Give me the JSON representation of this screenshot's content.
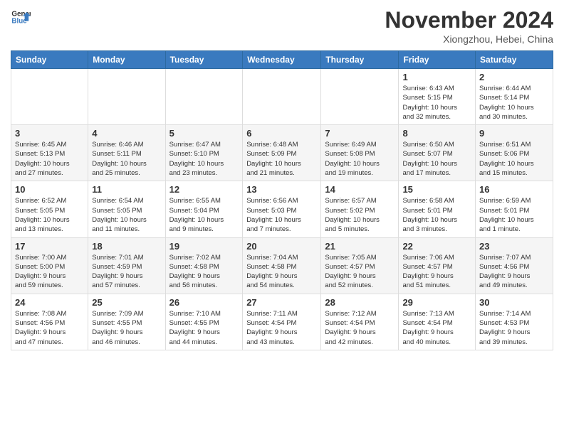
{
  "header": {
    "logo_line1": "General",
    "logo_line2": "Blue",
    "month": "November 2024",
    "location": "Xiongzhou, Hebei, China"
  },
  "weekdays": [
    "Sunday",
    "Monday",
    "Tuesday",
    "Wednesday",
    "Thursday",
    "Friday",
    "Saturday"
  ],
  "weeks": [
    [
      {
        "day": "",
        "info": ""
      },
      {
        "day": "",
        "info": ""
      },
      {
        "day": "",
        "info": ""
      },
      {
        "day": "",
        "info": ""
      },
      {
        "day": "",
        "info": ""
      },
      {
        "day": "1",
        "info": "Sunrise: 6:43 AM\nSunset: 5:15 PM\nDaylight: 10 hours\nand 32 minutes."
      },
      {
        "day": "2",
        "info": "Sunrise: 6:44 AM\nSunset: 5:14 PM\nDaylight: 10 hours\nand 30 minutes."
      }
    ],
    [
      {
        "day": "3",
        "info": "Sunrise: 6:45 AM\nSunset: 5:13 PM\nDaylight: 10 hours\nand 27 minutes."
      },
      {
        "day": "4",
        "info": "Sunrise: 6:46 AM\nSunset: 5:11 PM\nDaylight: 10 hours\nand 25 minutes."
      },
      {
        "day": "5",
        "info": "Sunrise: 6:47 AM\nSunset: 5:10 PM\nDaylight: 10 hours\nand 23 minutes."
      },
      {
        "day": "6",
        "info": "Sunrise: 6:48 AM\nSunset: 5:09 PM\nDaylight: 10 hours\nand 21 minutes."
      },
      {
        "day": "7",
        "info": "Sunrise: 6:49 AM\nSunset: 5:08 PM\nDaylight: 10 hours\nand 19 minutes."
      },
      {
        "day": "8",
        "info": "Sunrise: 6:50 AM\nSunset: 5:07 PM\nDaylight: 10 hours\nand 17 minutes."
      },
      {
        "day": "9",
        "info": "Sunrise: 6:51 AM\nSunset: 5:06 PM\nDaylight: 10 hours\nand 15 minutes."
      }
    ],
    [
      {
        "day": "10",
        "info": "Sunrise: 6:52 AM\nSunset: 5:05 PM\nDaylight: 10 hours\nand 13 minutes."
      },
      {
        "day": "11",
        "info": "Sunrise: 6:54 AM\nSunset: 5:05 PM\nDaylight: 10 hours\nand 11 minutes."
      },
      {
        "day": "12",
        "info": "Sunrise: 6:55 AM\nSunset: 5:04 PM\nDaylight: 10 hours\nand 9 minutes."
      },
      {
        "day": "13",
        "info": "Sunrise: 6:56 AM\nSunset: 5:03 PM\nDaylight: 10 hours\nand 7 minutes."
      },
      {
        "day": "14",
        "info": "Sunrise: 6:57 AM\nSunset: 5:02 PM\nDaylight: 10 hours\nand 5 minutes."
      },
      {
        "day": "15",
        "info": "Sunrise: 6:58 AM\nSunset: 5:01 PM\nDaylight: 10 hours\nand 3 minutes."
      },
      {
        "day": "16",
        "info": "Sunrise: 6:59 AM\nSunset: 5:01 PM\nDaylight: 10 hours\nand 1 minute."
      }
    ],
    [
      {
        "day": "17",
        "info": "Sunrise: 7:00 AM\nSunset: 5:00 PM\nDaylight: 9 hours\nand 59 minutes."
      },
      {
        "day": "18",
        "info": "Sunrise: 7:01 AM\nSunset: 4:59 PM\nDaylight: 9 hours\nand 57 minutes."
      },
      {
        "day": "19",
        "info": "Sunrise: 7:02 AM\nSunset: 4:58 PM\nDaylight: 9 hours\nand 56 minutes."
      },
      {
        "day": "20",
        "info": "Sunrise: 7:04 AM\nSunset: 4:58 PM\nDaylight: 9 hours\nand 54 minutes."
      },
      {
        "day": "21",
        "info": "Sunrise: 7:05 AM\nSunset: 4:57 PM\nDaylight: 9 hours\nand 52 minutes."
      },
      {
        "day": "22",
        "info": "Sunrise: 7:06 AM\nSunset: 4:57 PM\nDaylight: 9 hours\nand 51 minutes."
      },
      {
        "day": "23",
        "info": "Sunrise: 7:07 AM\nSunset: 4:56 PM\nDaylight: 9 hours\nand 49 minutes."
      }
    ],
    [
      {
        "day": "24",
        "info": "Sunrise: 7:08 AM\nSunset: 4:56 PM\nDaylight: 9 hours\nand 47 minutes."
      },
      {
        "day": "25",
        "info": "Sunrise: 7:09 AM\nSunset: 4:55 PM\nDaylight: 9 hours\nand 46 minutes."
      },
      {
        "day": "26",
        "info": "Sunrise: 7:10 AM\nSunset: 4:55 PM\nDaylight: 9 hours\nand 44 minutes."
      },
      {
        "day": "27",
        "info": "Sunrise: 7:11 AM\nSunset: 4:54 PM\nDaylight: 9 hours\nand 43 minutes."
      },
      {
        "day": "28",
        "info": "Sunrise: 7:12 AM\nSunset: 4:54 PM\nDaylight: 9 hours\nand 42 minutes."
      },
      {
        "day": "29",
        "info": "Sunrise: 7:13 AM\nSunset: 4:54 PM\nDaylight: 9 hours\nand 40 minutes."
      },
      {
        "day": "30",
        "info": "Sunrise: 7:14 AM\nSunset: 4:53 PM\nDaylight: 9 hours\nand 39 minutes."
      }
    ]
  ]
}
